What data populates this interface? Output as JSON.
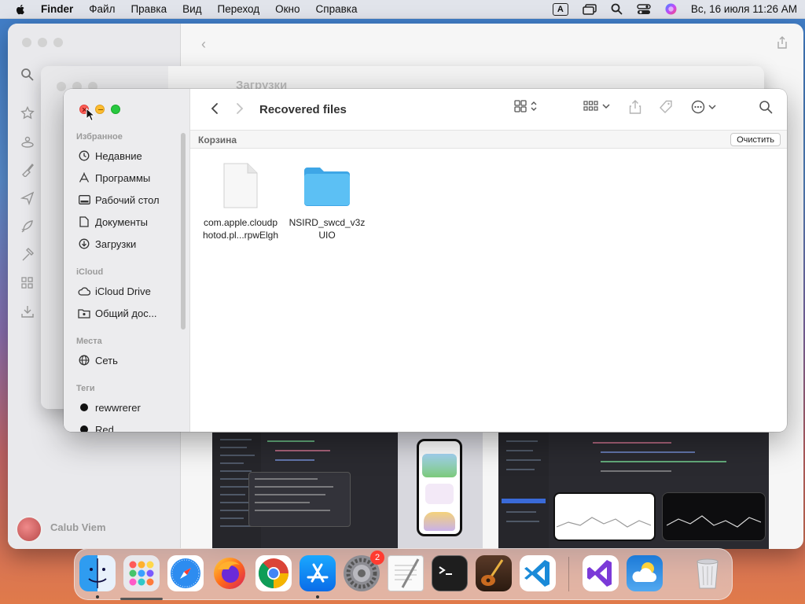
{
  "menubar": {
    "app_name": "Finder",
    "menus": [
      "Файл",
      "Правка",
      "Вид",
      "Переход",
      "Окно",
      "Справка"
    ],
    "input_indicator": "A",
    "clock": "Вс, 16 июля  11:26 AM"
  },
  "back_window": {
    "user_name": "Calub Viem"
  },
  "middle_window": {
    "title": "Загрузки"
  },
  "finder": {
    "title": "Recovered files",
    "path_label": "Корзина",
    "empty_button": "Очистить",
    "sidebar": {
      "favorites_header": "Избранное",
      "favorites": [
        {
          "label": "Недавние",
          "icon": "clock-icon"
        },
        {
          "label": "Программы",
          "icon": "applications-icon"
        },
        {
          "label": "Рабочий стол",
          "icon": "desktop-icon"
        },
        {
          "label": "Документы",
          "icon": "document-icon"
        },
        {
          "label": "Загрузки",
          "icon": "download-icon"
        }
      ],
      "icloud_header": "iCloud",
      "icloud": [
        {
          "label": "iCloud Drive",
          "icon": "cloud-icon"
        },
        {
          "label": "Общий дос...",
          "icon": "shared-folder-icon"
        }
      ],
      "locations_header": "Места",
      "locations": [
        {
          "label": "Сеть",
          "icon": "globe-icon"
        }
      ],
      "tags_header": "Теги",
      "tags": [
        {
          "label": "rewwrerer",
          "color": "#111111"
        },
        {
          "label": "Red",
          "color": "#111111"
        }
      ]
    },
    "files": [
      {
        "name": "com.apple.cloudphotod.pl...rpwElgh",
        "line1": "com.apple.cloudp",
        "line2": "hotod.pl...rpwElgh",
        "type": "document"
      },
      {
        "name": "NSIRD_swcd_v3zUIO",
        "line1": "NSIRD_swcd_v3z",
        "line2": "UIO",
        "type": "folder"
      }
    ]
  },
  "dock": {
    "apps": [
      {
        "name": "Finder",
        "icon": "finder-icon"
      },
      {
        "name": "Launchpad",
        "icon": "launchpad-icon"
      },
      {
        "name": "Safari",
        "icon": "safari-icon"
      },
      {
        "name": "Firefox",
        "icon": "firefox-icon"
      },
      {
        "name": "Chrome",
        "icon": "chrome-icon"
      },
      {
        "name": "App Store",
        "icon": "app-store-icon"
      },
      {
        "name": "System Settings",
        "icon": "settings-icon",
        "badge": "2"
      },
      {
        "name": "TextEdit",
        "icon": "textedit-icon"
      },
      {
        "name": "Terminal",
        "icon": "terminal-icon"
      },
      {
        "name": "Instruments",
        "icon": "instruments-icon"
      },
      {
        "name": "Visual Studio Code",
        "icon": "vscode-icon"
      },
      {
        "name": "Visual Studio",
        "icon": "visual-studio-icon"
      },
      {
        "name": "Weather",
        "icon": "weather-icon"
      },
      {
        "name": "Trash",
        "icon": "trash-icon"
      }
    ]
  },
  "colors": {
    "close": "#ff5f57",
    "minimize": "#febc2e",
    "maximize": "#28c840",
    "folder": "#4fb6f0",
    "badge": "#ff3b30"
  }
}
